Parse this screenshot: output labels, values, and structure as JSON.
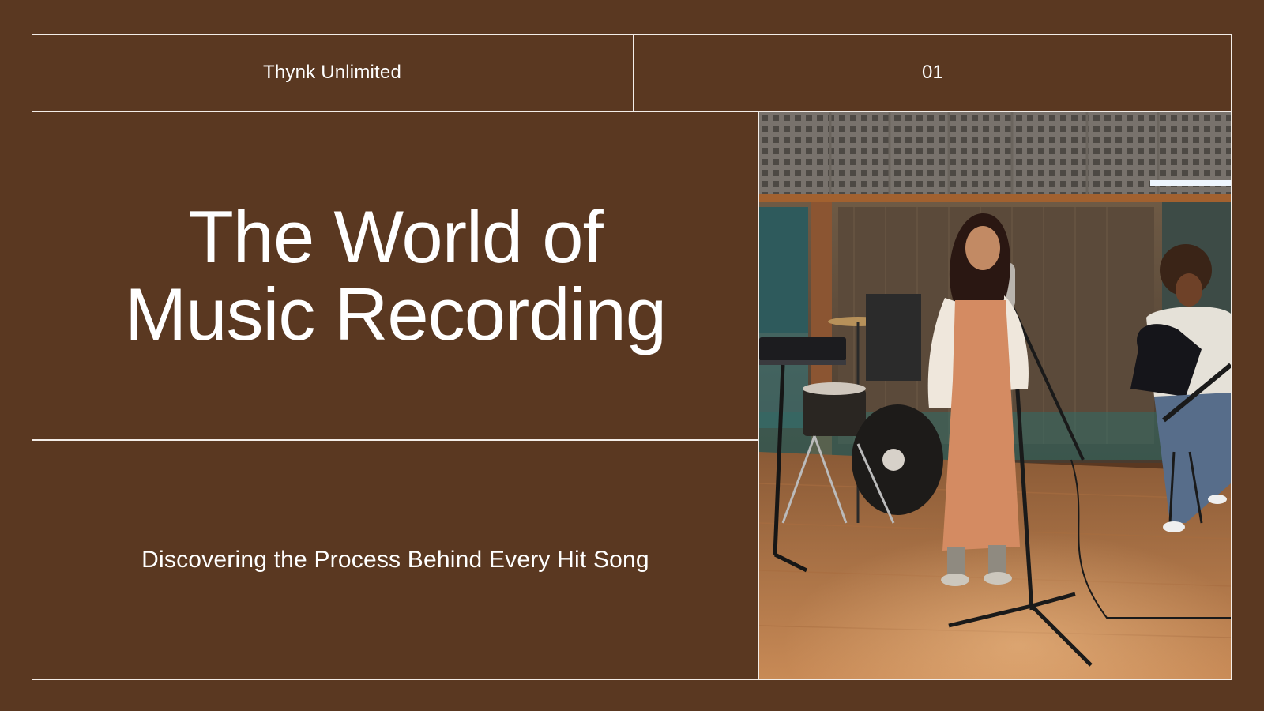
{
  "header": {
    "brand": "Thynk Unlimited",
    "page_number": "01"
  },
  "title": "The World of Music Recording",
  "subtitle": "Discovering the Process Behind Every Hit Song",
  "photo": {
    "subject": "recording-studio-band-photo"
  },
  "colors": {
    "background": "#5a3821",
    "lines": "#f3ede8",
    "text": "#ffffff"
  }
}
